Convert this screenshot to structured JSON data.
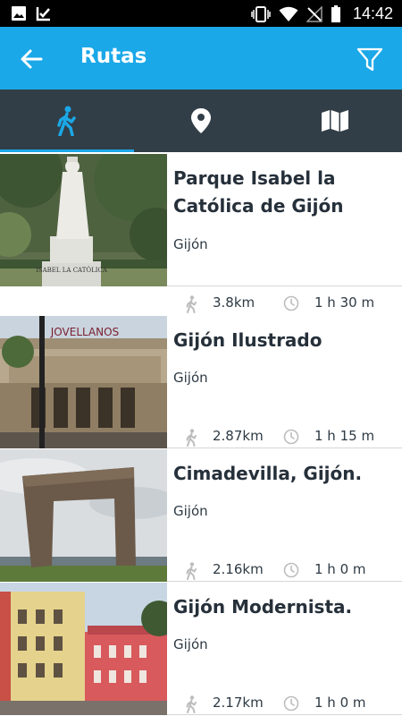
{
  "status_bar": {
    "time": "14:42",
    "left_icons": [
      "image-icon",
      "check-doc-icon"
    ],
    "right_icons": [
      "vibrate-icon",
      "wifi-icon",
      "no-signal-icon",
      "battery-icon"
    ]
  },
  "app_bar": {
    "title": "Rutas",
    "back_icon": "arrow-left-icon",
    "filter_icon": "filter-icon",
    "color": "#1ba8e8"
  },
  "tabs": [
    {
      "icon": "walk-icon",
      "active": true
    },
    {
      "icon": "location-pin-icon",
      "active": false
    },
    {
      "icon": "map-icon",
      "active": false
    }
  ],
  "routes": [
    {
      "name": "Parque Isabel la Católica de Gijón",
      "city": "Gijón",
      "distance": "3.8km",
      "duration": "1 h 30 m",
      "statue_text": "ISABEL LA CATÓLICA"
    },
    {
      "name": "Gijón Ilustrado",
      "city": "Gijón",
      "distance": "2.87km",
      "duration": "1 h 15 m",
      "building_text": "JOVELLANOS"
    },
    {
      "name": "Cimadevilla, Gijón.",
      "city": "Gijón",
      "distance": "2.16km",
      "duration": "1 h 0 m"
    },
    {
      "name": "Gijón Modernista.",
      "city": "Gijón",
      "distance": "2.17km",
      "duration": "1 h 0 m"
    }
  ],
  "colors": {
    "accent": "#1ba8e8",
    "tab_bar": "#323e47",
    "text": "#26303a"
  }
}
